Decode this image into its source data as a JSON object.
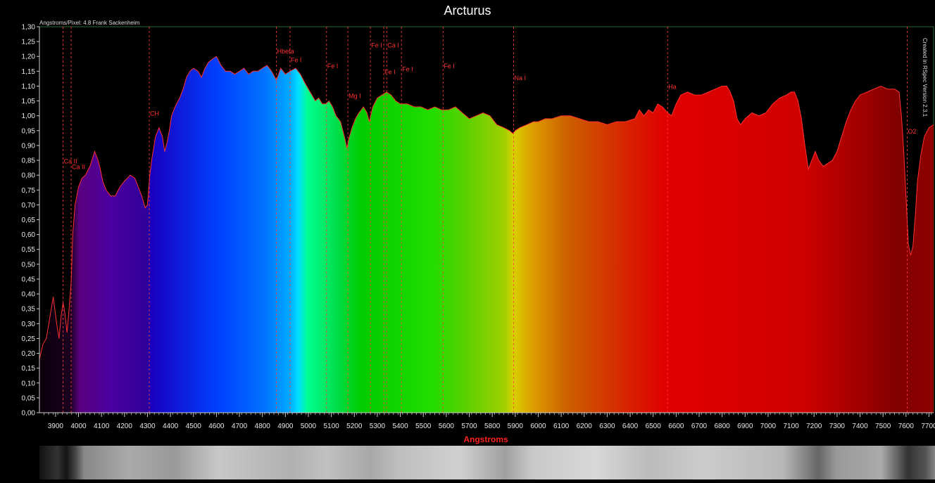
{
  "title": "Arcturus",
  "subtitle": "Angstroms/Pixel: 4.8 Frank Sackenheim",
  "credit": "Created in RSpec Version 2.3.1",
  "chart_data": {
    "type": "area",
    "xlabel": "Angstroms",
    "ylabel": "",
    "xlim": [
      3830,
      7720
    ],
    "ylim": [
      0,
      1.3
    ],
    "x_ticks": [
      3900,
      4000,
      4100,
      4200,
      4300,
      4400,
      4500,
      4600,
      4700,
      4800,
      4900,
      5000,
      5100,
      5200,
      5300,
      5400,
      5500,
      5600,
      5700,
      5800,
      5900,
      6000,
      6100,
      6200,
      6300,
      6400,
      6500,
      6600,
      6700,
      6800,
      6900,
      7000,
      7100,
      7200,
      7300,
      7400,
      7500,
      7600,
      7700
    ],
    "y_ticks": [
      "0,00",
      "0,05",
      "0,10",
      "0,15",
      "0,20",
      "0,25",
      "0,30",
      "0,35",
      "0,40",
      "0,45",
      "0,50",
      "0,55",
      "0,60",
      "0,65",
      "0,70",
      "0,75",
      "0,80",
      "0,85",
      "0,90",
      "0,95",
      "1,00",
      "1,05",
      "1,10",
      "1,15",
      "1,20",
      "1,25",
      "1,30"
    ],
    "grid": false,
    "series": [
      {
        "x": [
          3830,
          3845,
          3860,
          3875,
          3890,
          3905,
          3915,
          3925,
          3933,
          3940,
          3950,
          3958,
          3968,
          3975,
          3985,
          4000,
          4015,
          4030,
          4050,
          4070,
          4085,
          4095,
          4105,
          4120,
          4140,
          4160,
          4180,
          4200,
          4225,
          4245,
          4260,
          4275,
          4290,
          4300,
          4310,
          4320,
          4335,
          4350,
          4365,
          4375,
          4385,
          4395,
          4405,
          4420,
          4440,
          4455,
          4470,
          4485,
          4500,
          4520,
          4535,
          4550,
          4565,
          4580,
          4600,
          4620,
          4640,
          4660,
          4680,
          4700,
          4720,
          4740,
          4760,
          4780,
          4800,
          4820,
          4840,
          4861,
          4880,
          4900,
          4920,
          4945,
          4965,
          4985,
          5000,
          5015,
          5030,
          5045,
          5060,
          5075,
          5090,
          5105,
          5120,
          5140,
          5160,
          5168,
          5175,
          5190,
          5205,
          5220,
          5240,
          5255,
          5265,
          5280,
          5300,
          5320,
          5340,
          5360,
          5380,
          5400,
          5430,
          5460,
          5490,
          5520,
          5550,
          5580,
          5610,
          5640,
          5670,
          5700,
          5730,
          5760,
          5790,
          5820,
          5850,
          5875,
          5890,
          5900,
          5920,
          5950,
          5980,
          6000,
          6030,
          6060,
          6100,
          6140,
          6180,
          6220,
          6260,
          6300,
          6340,
          6380,
          6420,
          6440,
          6460,
          6480,
          6500,
          6520,
          6540,
          6563,
          6580,
          6600,
          6620,
          6650,
          6680,
          6710,
          6740,
          6770,
          6800,
          6820,
          6835,
          6850,
          6865,
          6880,
          6900,
          6930,
          6960,
          6990,
          7020,
          7050,
          7080,
          7100,
          7115,
          7130,
          7145,
          7160,
          7175,
          7190,
          7205,
          7220,
          7240,
          7260,
          7280,
          7300,
          7320,
          7340,
          7360,
          7380,
          7400,
          7430,
          7460,
          7490,
          7520,
          7550,
          7570,
          7580,
          7590,
          7600,
          7610,
          7620,
          7630,
          7640,
          7650,
          7665,
          7680,
          7700,
          7720
        ],
        "y": [
          0.18,
          0.23,
          0.25,
          0.32,
          0.39,
          0.3,
          0.25,
          0.33,
          0.37,
          0.34,
          0.27,
          0.34,
          0.44,
          0.6,
          0.7,
          0.76,
          0.79,
          0.8,
          0.83,
          0.88,
          0.85,
          0.82,
          0.78,
          0.75,
          0.73,
          0.73,
          0.76,
          0.78,
          0.8,
          0.79,
          0.76,
          0.73,
          0.69,
          0.7,
          0.8,
          0.86,
          0.93,
          0.96,
          0.93,
          0.88,
          0.91,
          0.95,
          1.0,
          1.03,
          1.06,
          1.09,
          1.13,
          1.15,
          1.16,
          1.15,
          1.13,
          1.16,
          1.18,
          1.19,
          1.2,
          1.17,
          1.15,
          1.15,
          1.14,
          1.15,
          1.16,
          1.14,
          1.15,
          1.15,
          1.16,
          1.17,
          1.15,
          1.12,
          1.16,
          1.14,
          1.15,
          1.16,
          1.14,
          1.11,
          1.09,
          1.07,
          1.05,
          1.06,
          1.04,
          1.04,
          1.05,
          1.03,
          1.0,
          0.98,
          0.92,
          0.89,
          0.92,
          0.96,
          0.99,
          1.01,
          1.03,
          1.01,
          0.98,
          1.03,
          1.06,
          1.07,
          1.08,
          1.07,
          1.05,
          1.04,
          1.04,
          1.03,
          1.03,
          1.02,
          1.03,
          1.02,
          1.02,
          1.03,
          1.01,
          0.99,
          1.0,
          1.01,
          1.0,
          0.97,
          0.96,
          0.95,
          0.94,
          0.95,
          0.96,
          0.97,
          0.98,
          0.98,
          0.99,
          0.99,
          1.0,
          1.0,
          0.99,
          0.98,
          0.98,
          0.97,
          0.98,
          0.98,
          0.99,
          1.02,
          1.0,
          1.02,
          1.01,
          1.04,
          1.03,
          1.01,
          1.0,
          1.04,
          1.07,
          1.08,
          1.07,
          1.07,
          1.08,
          1.09,
          1.1,
          1.1,
          1.08,
          1.05,
          0.99,
          0.97,
          0.99,
          1.01,
          1.0,
          1.01,
          1.04,
          1.06,
          1.07,
          1.08,
          1.08,
          1.05,
          0.99,
          0.9,
          0.82,
          0.85,
          0.88,
          0.85,
          0.83,
          0.84,
          0.85,
          0.88,
          0.93,
          0.98,
          1.02,
          1.05,
          1.07,
          1.08,
          1.09,
          1.1,
          1.09,
          1.09,
          1.08,
          1.0,
          0.88,
          0.73,
          0.57,
          0.53,
          0.56,
          0.66,
          0.78,
          0.87,
          0.93,
          0.96,
          0.97
        ]
      }
    ],
    "annotations": [
      {
        "label": "Ca II",
        "x": 3933,
        "y_label": 0.84
      },
      {
        "label": "Ca II",
        "x": 3968,
        "y_label": 0.82
      },
      {
        "label": "CH",
        "x": 4308,
        "y_label": 1.0
      },
      {
        "label": "Hbeta",
        "x": 4861,
        "y_label": 1.21
      },
      {
        "label": "Fe I",
        "x": 4920,
        "y_label": 1.18
      },
      {
        "label": "Fe I",
        "x": 5079,
        "y_label": 1.16
      },
      {
        "label": "Mg I",
        "x": 5172,
        "y_label": 1.06
      },
      {
        "label": "Fe I",
        "x": 5270,
        "y_label": 1.23
      },
      {
        "label": "Ca I",
        "x": 5341,
        "y_label": 1.23
      },
      {
        "label": "Fe I",
        "x": 5328,
        "y_label": 1.14
      },
      {
        "label": "Fe I",
        "x": 5405,
        "y_label": 1.15
      },
      {
        "label": "Fe I",
        "x": 5586,
        "y_label": 1.16
      },
      {
        "label": "Na I",
        "x": 5893,
        "y_label": 1.12
      },
      {
        "label": "Ha",
        "x": 6563,
        "y_label": 1.09
      },
      {
        "label": "O2",
        "x": 7605,
        "y_label": 0.94
      }
    ]
  }
}
